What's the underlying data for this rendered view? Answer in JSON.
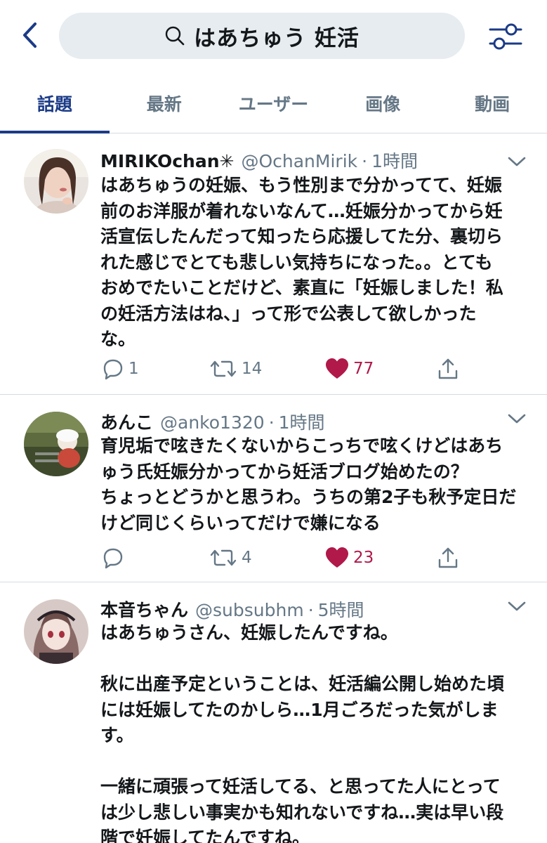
{
  "search": {
    "query": "はあちゅう 妊活"
  },
  "tabs": [
    {
      "label": "話題",
      "active": true
    },
    {
      "label": "最新",
      "active": false
    },
    {
      "label": "ユーザー",
      "active": false
    },
    {
      "label": "画像",
      "active": false
    },
    {
      "label": "動画",
      "active": false
    }
  ],
  "tweets": [
    {
      "name": "MIRIKOchan✳",
      "handle": "@OchanMirik",
      "time": "1時間",
      "body": "はあちゅうの妊娠、もう性別まで分かってて、妊娠\n前のお洋服が着れないなんて…妊娠分かってから妊\n活宣伝したんだって知ったら応援してた分、裏切ら\nれた感じでとても悲しい気持ちになった。。とても\nおめでたいことだけど、素直に「妊娠しました！私\nの妊活方法はね、」って形で公表して欲しかった\nな。",
      "replies": "1",
      "retweets": "14",
      "likes": "77"
    },
    {
      "name": "あんこ",
      "handle": "@anko1320",
      "time": "1時間",
      "body": "育児垢で呟きたくないからこっちで呟くけどはあち\nゅう氏妊娠分かってから妊活ブログ始めたの？\nちょっとどうかと思うわ。うちの第2子も秋予定日だ\nけど同じくらいってだけで嫌になる",
      "replies": "",
      "retweets": "4",
      "likes": "23"
    },
    {
      "name": "本音ちゃん",
      "handle": "@subsubhm",
      "time": "5時間",
      "body": "はあちゅうさん、妊娠したんですね。\n\n秋に出産予定ということは、妊活編公開し始めた頃\nには妊娠してたのかしら…1月ごろだった気がしま\nす。\n\n一緒に頑張って妊活してる、と思ってた人にとって\nは少し悲しい事実かも知れないですね…実は早い段\n階で妊娠してたんですね。",
      "replies": "",
      "retweets": "",
      "likes": ""
    }
  ],
  "colors": {
    "accent": "#1b3b87",
    "like": "#b0194a",
    "muted": "#657786",
    "search_bg": "#e6ecf0"
  },
  "icons": {
    "back": "chevron-left-icon",
    "search": "search-icon",
    "filter": "filter-sliders-icon",
    "caret": "chevron-down-icon",
    "reply": "reply-icon",
    "retweet": "retweet-icon",
    "like": "heart-icon",
    "share": "share-icon"
  }
}
